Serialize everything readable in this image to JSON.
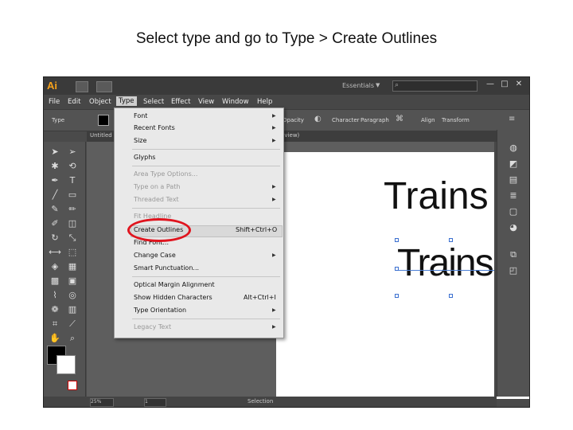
{
  "slide": {
    "title": "Select type and go to Type > Create Outlines"
  },
  "app": {
    "logo": "Ai",
    "workspace": "Essentials",
    "window_controls": [
      "—",
      "□",
      "✕"
    ]
  },
  "menubar": [
    "File",
    "Edit",
    "Object",
    "Type",
    "Select",
    "Effect",
    "View",
    "Window",
    "Help"
  ],
  "active_menu": "Type",
  "control_bar": {
    "left_label": "Type",
    "opacity_label": "Opacity",
    "character_label": "Character",
    "paragraph_label": "Paragraph",
    "align_label": "Align",
    "transform_label": "Transform"
  },
  "document": {
    "tab_left": "Untitled",
    "tab_right": "/K/Preview)"
  },
  "type_menu": {
    "items": [
      {
        "label": "Font",
        "submenu": true,
        "disabled": false
      },
      {
        "label": "Recent Fonts",
        "submenu": true,
        "disabled": false
      },
      {
        "label": "Size",
        "submenu": true,
        "disabled": false
      },
      {
        "label": "Glyphs",
        "submenu": false,
        "disabled": false
      },
      {
        "label": "Area Type Options...",
        "submenu": false,
        "disabled": true
      },
      {
        "label": "Type on a Path",
        "submenu": true,
        "disabled": true
      },
      {
        "label": "Threaded Text",
        "submenu": true,
        "disabled": true
      },
      {
        "label": "Fit Headline",
        "submenu": false,
        "disabled": true
      },
      {
        "label": "Create Outlines",
        "submenu": false,
        "disabled": false,
        "shortcut": "Shift+Ctrl+O",
        "highlighted": true
      },
      {
        "label": "Find Font...",
        "submenu": false,
        "disabled": false
      },
      {
        "label": "Change Case",
        "submenu": true,
        "disabled": false
      },
      {
        "label": "Smart Punctuation...",
        "submenu": false,
        "disabled": false
      },
      {
        "label": "Optical Margin Alignment",
        "submenu": false,
        "disabled": false
      },
      {
        "label": "Show Hidden Characters",
        "submenu": false,
        "disabled": false,
        "shortcut": "Alt+Ctrl+I"
      },
      {
        "label": "Type Orientation",
        "submenu": true,
        "disabled": false
      },
      {
        "label": "Legacy Text",
        "submenu": true,
        "disabled": true
      }
    ]
  },
  "artboard": {
    "text_top": "Trains",
    "text_outlined": "Trains"
  },
  "statusbar": {
    "zoom": "25%",
    "page": "1",
    "tool": "Selection"
  },
  "colors": {
    "annotation_circle": "#e0141e",
    "selection_blue": "#3a6fd0",
    "app_bg": "#4a4a4a"
  }
}
